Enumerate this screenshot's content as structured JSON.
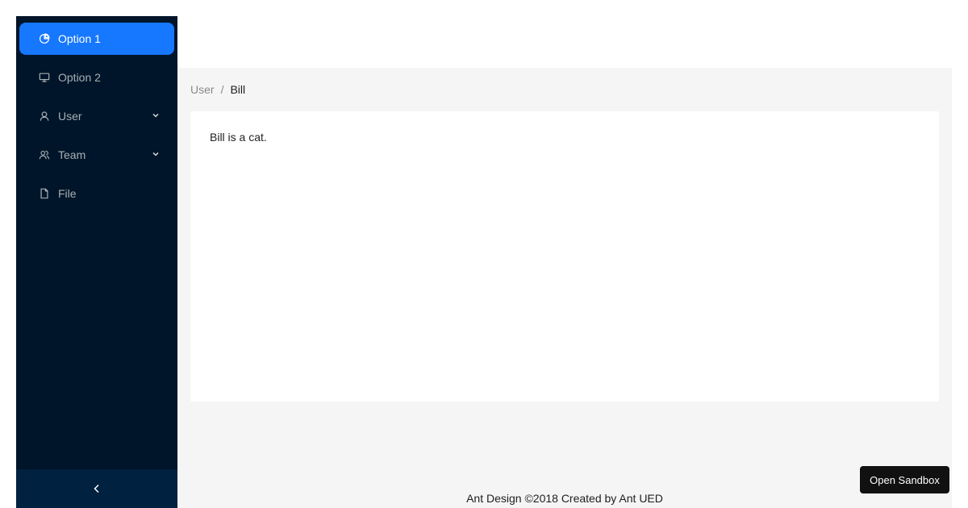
{
  "sidebar": {
    "items": [
      {
        "label": "Option 1",
        "icon": "pie-chart-icon",
        "active": true
      },
      {
        "label": "Option 2",
        "icon": "desktop-icon",
        "active": false
      },
      {
        "label": "User",
        "icon": "user-icon",
        "has_submenu": true
      },
      {
        "label": "Team",
        "icon": "team-icon",
        "has_submenu": true
      },
      {
        "label": "File",
        "icon": "file-icon",
        "active": false
      }
    ],
    "collapse_icon": "chevron-left-icon"
  },
  "breadcrumb": {
    "items": [
      "User",
      "Bill"
    ],
    "separator": "/"
  },
  "content": {
    "text": "Bill is a cat."
  },
  "footer": {
    "text": "Ant Design ©2018 Created by Ant UED"
  },
  "sandbox": {
    "label": "Open Sandbox"
  },
  "colors": {
    "sider_bg": "#001529",
    "trigger_bg": "#002140",
    "accent": "#1677ff",
    "layout_bg": "#f5f5f5"
  }
}
